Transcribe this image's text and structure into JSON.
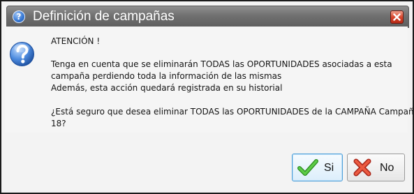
{
  "window": {
    "title": "Definición de campañas",
    "icons": {
      "title": "question-icon",
      "close": "close-icon",
      "message": "question-icon"
    }
  },
  "message": {
    "heading": "ATENCIÓN !",
    "line1": "Tenga en cuenta que se eliminarán TODAS las OPORTUNIDADES asociadas a esta",
    "line2": "campaña perdiendo toda la información de las mismas",
    "line3": "Además, esta acción quedará registrada en su historial",
    "line4": "¿Está seguro que desea eliminar TODAS las OPORTUNIDADES de la CAMPAÑA Campaña",
    "line5": "18?"
  },
  "buttons": {
    "yes": {
      "label": "Si",
      "icon": "checkmark-icon"
    },
    "no": {
      "label": "No",
      "icon": "x-icon"
    }
  },
  "colors": {
    "titlebar": "#707070",
    "close": "#d9472e",
    "icon_blue": "#3a7bd6",
    "check_green": "#3cae2d",
    "x_red": "#e0442b",
    "focus_border": "#4d9fd9"
  }
}
